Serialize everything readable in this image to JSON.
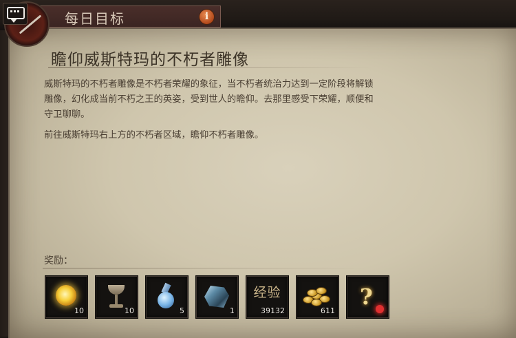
{
  "header": {
    "tab_title": "每日目标",
    "info_label": "i"
  },
  "quest": {
    "title": "瞻仰威斯特玛的不朽者雕像",
    "description_lines": [
      "威斯特玛的不朽者雕像是不朽者荣耀的象征，当不朽者统治力达到一定阶段将解锁",
      "雕像，幻化成当前不朽之王的英姿，受到世人的瞻仰。去那里感受下荣耀，顺便和",
      "守卫聊聊。"
    ],
    "instruction": "前往威斯特玛右上方的不朽者区域，瞻仰不朽者雕像。"
  },
  "rewards": {
    "label": "奖励：",
    "items": [
      {
        "icon": "glowing-orb-icon",
        "count": "10"
      },
      {
        "icon": "goblet-icon",
        "count": "10"
      },
      {
        "icon": "potion-icon",
        "count": "5"
      },
      {
        "icon": "crystal-ore-icon",
        "count": "1"
      },
      {
        "icon": "experience-icon",
        "text": "经验",
        "count": "39132"
      },
      {
        "icon": "gold-coins-icon",
        "count": "611"
      },
      {
        "icon": "mystery-item-icon",
        "count": ""
      }
    ]
  }
}
